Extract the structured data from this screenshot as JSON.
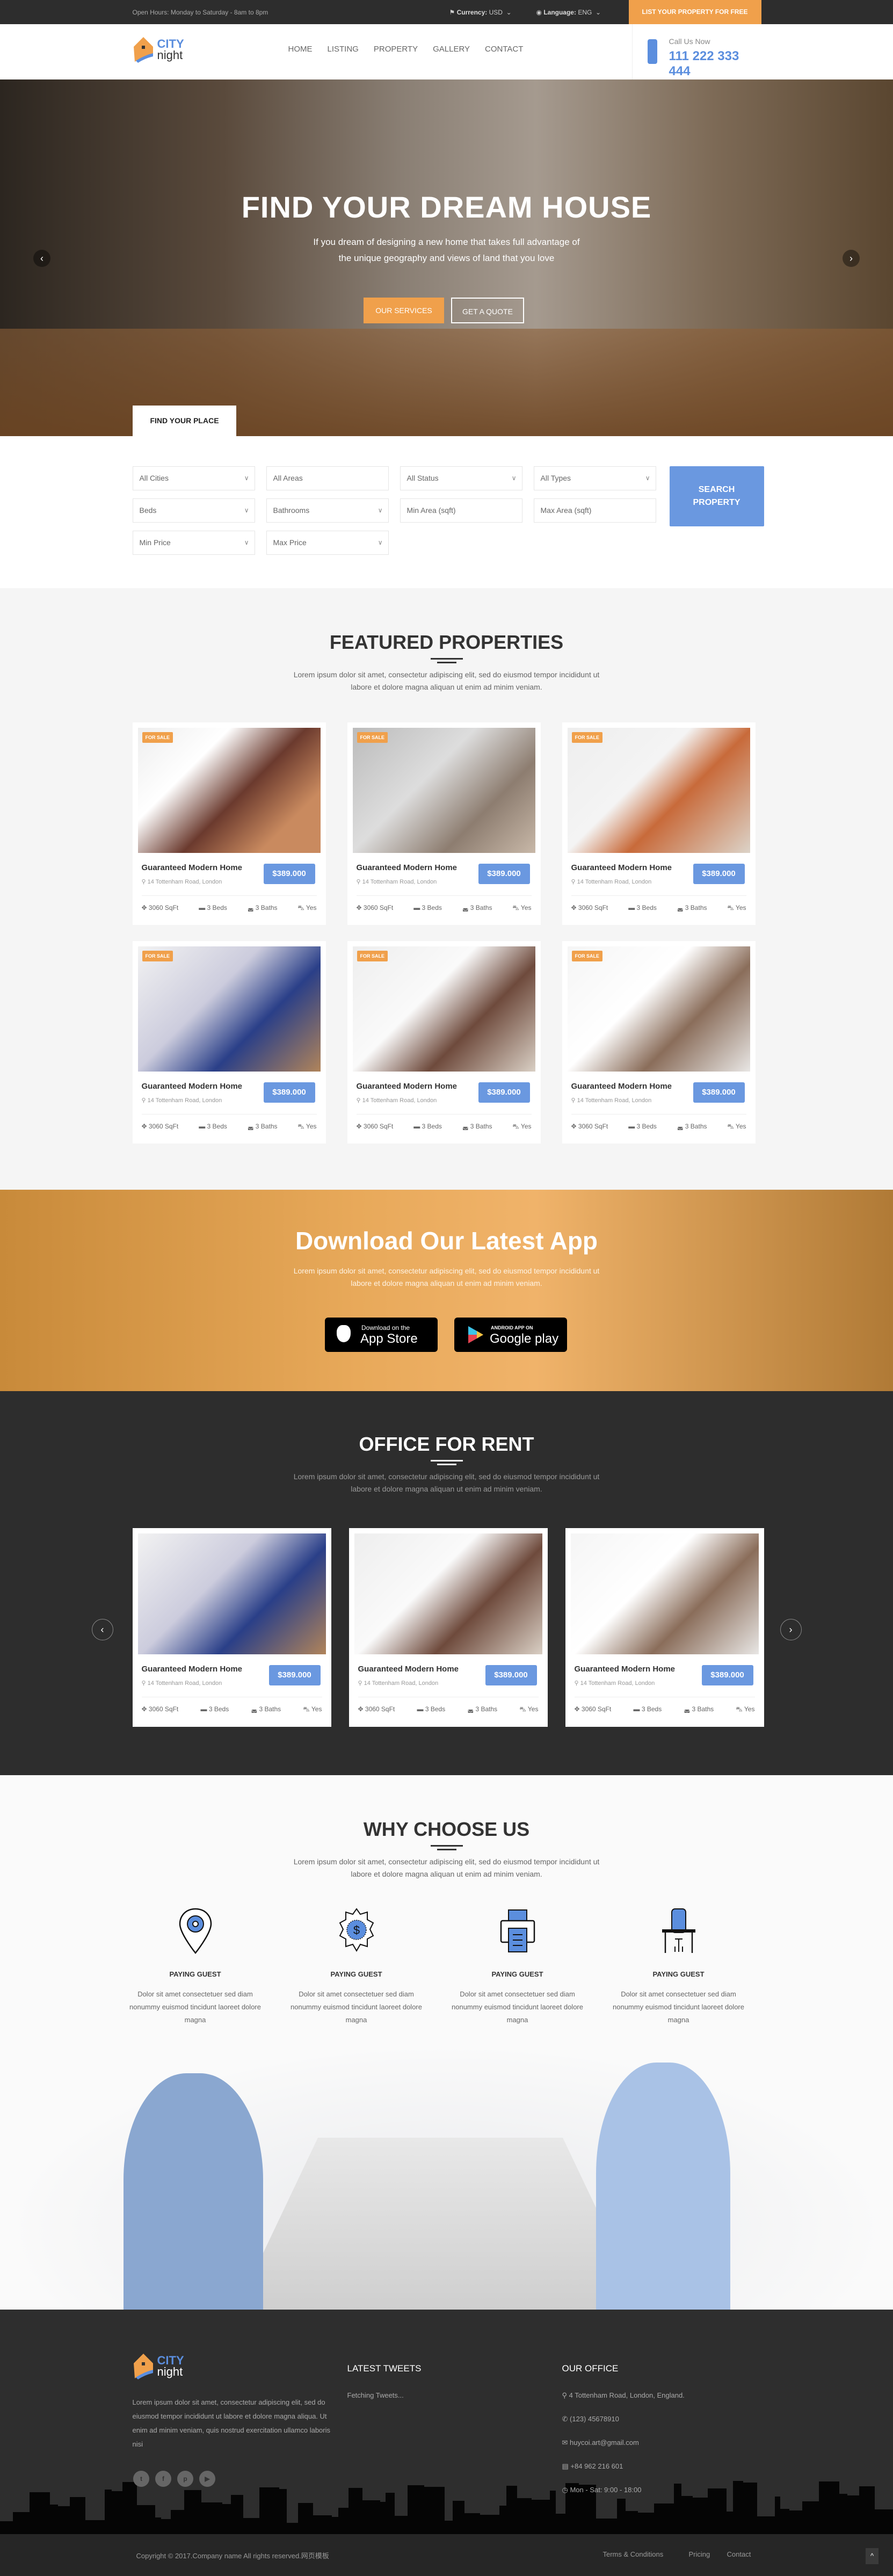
{
  "topbar": {
    "hours": "Open Hours: Monday to Saturday - 8am to 8pm",
    "currency_label": "Currency:",
    "currency_value": "USD",
    "language_label": "Language:",
    "language_value": "ENG",
    "list_property": "LIST YOUR PROPERTY FOR FREE"
  },
  "brand": {
    "name_top": "CITY",
    "name_bottom": "night",
    "accent": "#5b8ede",
    "orange": "#f0a04b"
  },
  "nav": [
    "HOME",
    "LISTING",
    "PROPERTY",
    "GALLERY",
    "CONTACT"
  ],
  "call": {
    "label": "Call Us Now",
    "number": "111 222 333 444"
  },
  "hero": {
    "title": "FIND YOUR DREAM HOUSE",
    "subtitle_line1": "If you dream of designing a new home that takes full advantage of",
    "subtitle_line2": "the unique geography and views of land that you love",
    "btn_services": "OUR SERVICES",
    "btn_quote": "GET A QUOTE"
  },
  "search": {
    "tab": "FIND YOUR PLACE",
    "fields": [
      "All Cities",
      "All Areas",
      "All Status",
      "All Types",
      "Beds",
      "Bathrooms",
      "Min Area (sqft)",
      "Max Area (sqft)",
      "Min Price",
      "Max Price"
    ],
    "button_line1": "SEARCH",
    "button_line2": "PROPERTY"
  },
  "featured": {
    "title": "FEATURED PROPERTIES",
    "lead1": "Lorem ipsum dolor sit amet, consectetur adipiscing elit, sed do eiusmod tempor incididunt ut",
    "lead2": "labore et dolore magna aliquan ut enim ad minim veniam."
  },
  "property": {
    "badge": "FOR SALE",
    "title": "Guaranteed Modern Home",
    "address": "14 Tottenham Road, London",
    "price": "$389.000",
    "area": "3060 SqFt",
    "beds": "3 Beds",
    "baths": "3 Baths",
    "garage": "Yes"
  },
  "app": {
    "title": "Download Our Latest App",
    "lead1": "Lorem ipsum dolor sit amet, consectetur adipiscing elit, sed do eiusmod tempor incididunt ut",
    "lead2": "labore et dolore magna aliquan ut enim ad minim veniam.",
    "appstore_small": "Download on the",
    "appstore_big": "App Store",
    "gplay_small": "ANDROID APP ON",
    "gplay_big": "Google play"
  },
  "office": {
    "title": "OFFICE FOR RENT",
    "lead1": "Lorem ipsum dolor sit amet, consectetur adipiscing elit, sed do eiusmod tempor incididunt ut",
    "lead2": "labore et dolore magna aliquan ut enim ad minim veniam."
  },
  "why": {
    "title": "WHY CHOOSE US",
    "lead1": "Lorem ipsum dolor sit amet, consectetur adipiscing elit, sed do eiusmod tempor incididunt ut",
    "lead2": "labore et dolore magna aliquan ut enim ad minim veniam.",
    "features": [
      {
        "icon": "location-gear-icon",
        "title": "PAYING GUEST",
        "text": "Dolor sit amet consectetuer sed diam nonummy euismod tincidunt laoreet dolore magna"
      },
      {
        "icon": "dollar-badge-icon",
        "title": "PAYING GUEST",
        "text": "Dolor sit amet consectetuer sed diam nonummy euismod tincidunt laoreet dolore magna"
      },
      {
        "icon": "printer-icon",
        "title": "PAYING GUEST",
        "text": "Dolor sit amet consectetuer sed diam nonummy euismod tincidunt laoreet dolore magna"
      },
      {
        "icon": "office-chair-icon",
        "title": "PAYING GUEST",
        "text": "Dolor sit amet consectetuer sed diam nonummy euismod tincidunt laoreet dolore magna"
      }
    ]
  },
  "footer": {
    "about": "Lorem ipsum dolor sit amet, consectetur adipiscing elit, sed do eiusmod tempor incididunt ut labore et dolore magna aliqua. Ut enim ad minim veniam, quis nostrud exercitation ullamco laboris nisi",
    "tweets_title": "LATEST TWEETS",
    "tweets_text": "Fetching Tweets...",
    "office_title": "OUR OFFICE",
    "address": "4 Tottenham Road, London, England.",
    "phone": "(123) 45678910",
    "email": "huycoi.art@gmail.com",
    "fax": "+84 962 216 601",
    "hours": "Mon - Sat: 9:00 - 18:00",
    "social": [
      "twitter-icon",
      "facebook-icon",
      "pinterest-icon",
      "youtube-icon"
    ]
  },
  "bottom": {
    "copyright": "Copyright © 2017.Company name All rights reserved.网页模板",
    "links": [
      "Terms & Conditions",
      "Pricing",
      "Contact"
    ]
  }
}
